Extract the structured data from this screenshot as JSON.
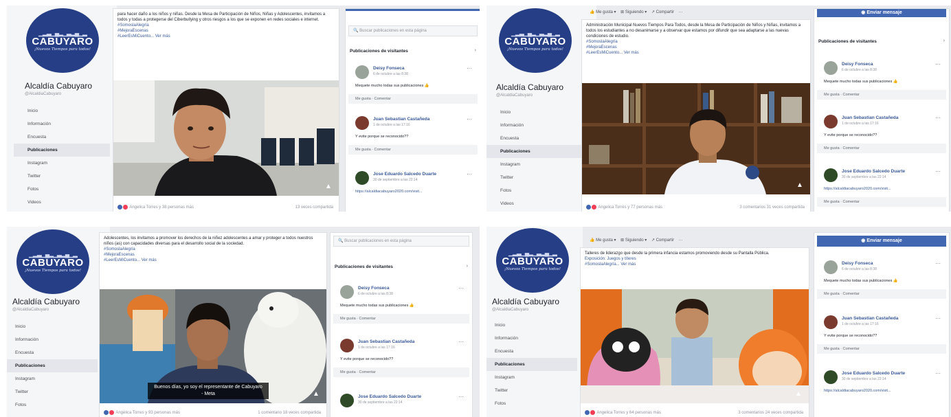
{
  "page": {
    "name": "Alcaldía Cabuyaro",
    "handle": "@AlcaldiaCabuyaro",
    "logo_name": "CABUYARO",
    "logo_skyline": "▁▂▃▁▄▂▁▃▂▄▁▂",
    "logo_tagline": "¡Nuevos Tiempos para todos!",
    "nav": [
      "Inicio",
      "Información",
      "Encuesta",
      "Publicaciones",
      "Instagram",
      "Twitter",
      "Fotos",
      "Videos"
    ],
    "active_nav": "Publicaciones"
  },
  "post_actions": {
    "like": "👍 Me gusta ▾",
    "follow": "⊞ Siguiendo ▾",
    "share": "↗ Compartir",
    "more": "···"
  },
  "sidebar": {
    "search_placeholder": "🔍 Buscar publicaciones en esta página",
    "section_title": "Publicaciones de visitantes",
    "arrow": "›",
    "send_message": "Enviar mensaje",
    "like_comment": "Me gusta · Comentar",
    "visitors": [
      {
        "name": "Deisy Fonseca",
        "date": "6 de octubre a las 8:38",
        "text": "Mequete mucho todas sus publicaciones 👍"
      },
      {
        "name": "Juan Sebastian Castañeda",
        "date": "1 de octubre a las 17:16",
        "text": "Y evite porque se reconocido??"
      },
      {
        "name": "Jose Eduardo Salcedo Duarte",
        "date": "30 de septiembre a las 22:14",
        "text": "https://alcaldiacabuyaro2020.com/visit..."
      }
    ]
  },
  "posts": [
    {
      "text": "para hacer daño a los niños y niñas. Desde la Mesa de Participación de Niños, Niñas y Adolescentes, invitamos a todos y todas a protegerse del Ciberbullying y otros riesgos a los que se exponen en redes sociales e internet.",
      "tags": [
        "#SomoslaAlegría",
        "#MejoraEscenas",
        "#LeerEsMiCuento... Ver más"
      ],
      "reactions": "Angelica Torres y 38 personas más",
      "shares": "13 veces compartida"
    },
    {
      "text": "Administración Municipal Nuevos Tiempos Para Todos, desde la Mesa de Participación de Niños y Niñas, invitamos a todos los estudiantes a no desanimarse y a observar que estamos por difundir que sea adaptarse a las nuevas condiciones de estudio.",
      "tags": [
        "#SomoslaAlegría",
        "#MejoraEscenas",
        "#LeerEsMiCuento... Ver más"
      ],
      "reactions": "Angelica Torres y 77 personas más",
      "shares": "3 comentarios  31 veces compartida"
    },
    {
      "text": "Adolescentes, los invitamos a promover los derechos de la niñez adolescentes a amar y proteger a todos nuestros niños (as) con capacidades diversas para el desarrollo social de la sociedad.",
      "tags": [
        "#SomoslaAlegría",
        "#MejoraEscenas",
        "#LeerEsMiCuento... Ver más"
      ],
      "caption": "Buenos días, yo soy el representante de Cabuyaro - Meta",
      "reactions": "Angelica Torres y 93 personas más",
      "shares": "1 comentario  18 veces compartida"
    },
    {
      "text": "Talleres de liderazgo que desde la primera infancia estamos promoviendo desde su Pantalla Pública.",
      "tags": [
        "Exposición: Juegos y títeres",
        "#SomoslaAlegría... Ver más"
      ],
      "reactions": "Angelica Torres y 64 personas más",
      "shares": "3 comentarios  24 veces compartida"
    }
  ],
  "colors": {
    "brand_navy": "#263e86",
    "facebook_blue": "#4267b2",
    "link": "#385898"
  }
}
